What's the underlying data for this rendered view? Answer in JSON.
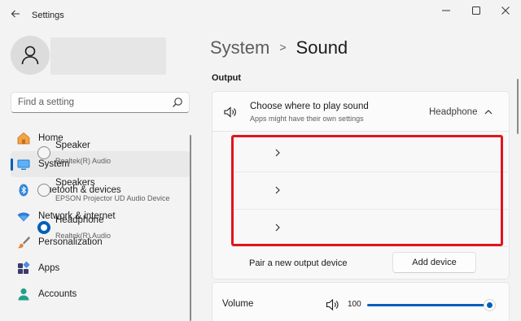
{
  "window": {
    "title": "Settings",
    "back_icon": "arrow-left-icon",
    "controls": [
      "minimize-icon",
      "maximize-icon",
      "close-icon"
    ]
  },
  "sidebar": {
    "search": {
      "placeholder": "Find a setting",
      "icon": "search-icon"
    },
    "items": [
      {
        "label": "Home",
        "icon": "home-icon",
        "active": false
      },
      {
        "label": "System",
        "icon": "monitor-icon",
        "active": true
      },
      {
        "label": "Bluetooth & devices",
        "icon": "bluetooth-icon",
        "active": false
      },
      {
        "label": "Network & internet",
        "icon": "wifi-icon",
        "active": false
      },
      {
        "label": "Personalization",
        "icon": "brush-icon",
        "active": false
      },
      {
        "label": "Apps",
        "icon": "apps-icon",
        "active": false
      },
      {
        "label": "Accounts",
        "icon": "person-icon",
        "active": false
      }
    ]
  },
  "main": {
    "breadcrumb": {
      "parent": "System",
      "separator": ">",
      "current": "Sound"
    },
    "section_title": "Output",
    "output": {
      "title": "Choose where to play sound",
      "subtitle": "Apps might have their own settings",
      "value": "Headphone",
      "expanded": true
    },
    "devices": [
      {
        "name": "Speaker",
        "detail": "Realtek(R) Audio",
        "selected": false
      },
      {
        "name": "Speakers",
        "detail": "EPSON Projector UD Audio Device",
        "selected": false
      },
      {
        "name": "Headphone",
        "detail": "Realtek(R) Audio",
        "selected": true
      }
    ],
    "pair": {
      "label": "Pair a new output device",
      "button": "Add device"
    },
    "volume": {
      "label": "Volume",
      "value": "100",
      "level": 1.0
    }
  },
  "colors": {
    "accent": "#005fb8",
    "highlight": "#e1141b",
    "background": "#f3f3f3"
  }
}
